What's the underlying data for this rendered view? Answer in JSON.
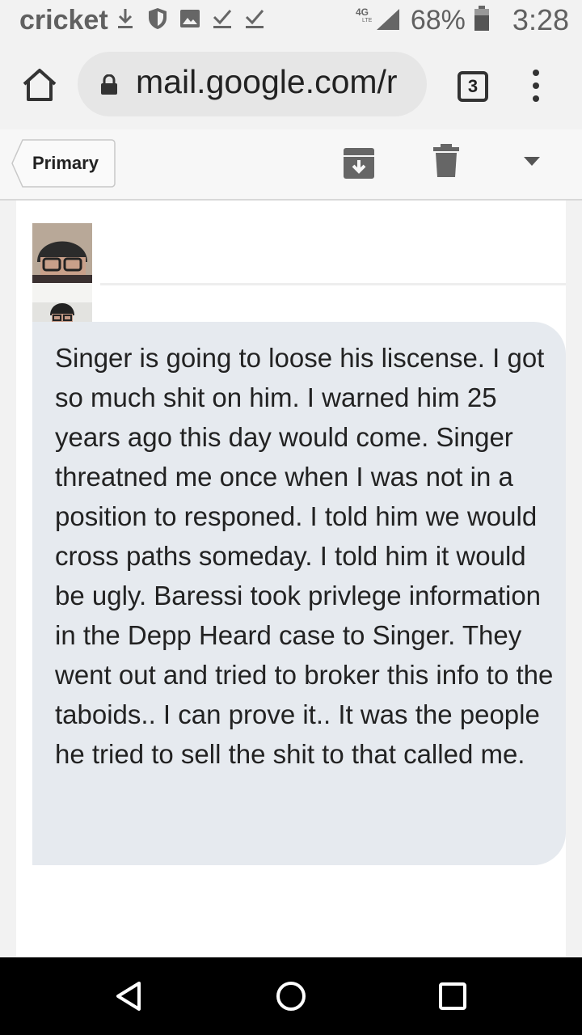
{
  "status_bar": {
    "carrier": "cricket",
    "network": "4G LTE",
    "battery": "68%",
    "time": "3:28",
    "icons": [
      "download-icon",
      "shield-icon",
      "image-icon",
      "check-download-icon",
      "check-download-icon",
      "signal-icon",
      "battery-icon"
    ]
  },
  "browser": {
    "url": "mail.google.com/r",
    "tab_count": "3",
    "icons": [
      "home-icon",
      "lock-icon",
      "overflow-menu-icon"
    ]
  },
  "toolbar": {
    "back_label": "Primary",
    "icons": [
      "archive-icon",
      "trash-icon",
      "dropdown-arrow-icon"
    ]
  },
  "message": {
    "body": "Singer is going to loose his liscense. I got so much shit on him. I warned him 25 years ago this day would come. Singer threatned me once when I was not in a position to responed. I told him we would cross paths someday. I told him it would be ugly. Baressi took privlege information in the Depp Heard case to Singer. They went out and tried to broker this info to the taboids.. I can prove it.. It was the people he tried to sell the shit to that called me."
  },
  "nav_bar": {
    "icons": [
      "back-icon",
      "home-circle-icon",
      "recents-icon"
    ]
  }
}
